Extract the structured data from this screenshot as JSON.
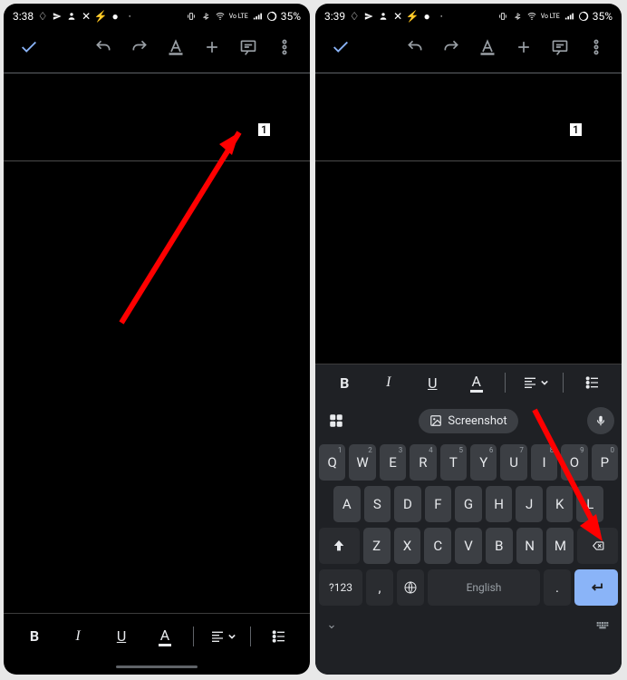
{
  "left": {
    "status": {
      "time": "3:38",
      "battery": "35%",
      "volte": "Vo LTE"
    },
    "doc": {
      "page_number": "1"
    }
  },
  "right": {
    "status": {
      "time": "3:39",
      "battery": "35%",
      "volte": "Vo LTE"
    },
    "doc": {
      "page_number": "1"
    },
    "format": {
      "bold": "B",
      "italic": "I",
      "underline": "U",
      "textfmt": "A"
    },
    "suggestion": {
      "chip": "Screenshot"
    },
    "keyboard": {
      "row1": [
        {
          "k": "Q",
          "s": "1"
        },
        {
          "k": "W",
          "s": "2"
        },
        {
          "k": "E",
          "s": "3"
        },
        {
          "k": "R",
          "s": "4"
        },
        {
          "k": "T",
          "s": "5"
        },
        {
          "k": "Y",
          "s": "6"
        },
        {
          "k": "U",
          "s": "7"
        },
        {
          "k": "I",
          "s": "8"
        },
        {
          "k": "O",
          "s": "9"
        },
        {
          "k": "P",
          "s": "0"
        }
      ],
      "row2": [
        "A",
        "S",
        "D",
        "F",
        "G",
        "H",
        "J",
        "K",
        "L"
      ],
      "row3": [
        "Z",
        "X",
        "C",
        "V",
        "B",
        "N",
        "M"
      ],
      "sym": "?123",
      "lang": "English",
      "comma": ",",
      "period": "."
    }
  },
  "format_bottom": {
    "bold": "B",
    "italic": "I",
    "underline": "U",
    "textfmt": "A"
  }
}
